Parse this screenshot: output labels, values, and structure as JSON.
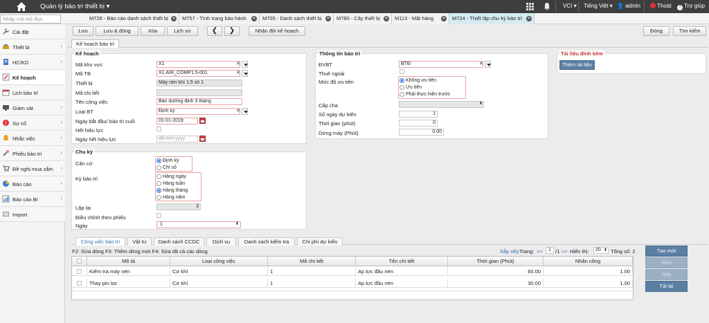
{
  "header": {
    "app_title": "Quản lý bảo trì thiết bị",
    "vci": "VCI",
    "language": "Tiếng Việt",
    "user": "admin",
    "logout": "Thoát",
    "help": "Trợ giúp"
  },
  "search": {
    "placeholder": "Nhập mã mô đun"
  },
  "doc_tabs": [
    {
      "label": "M726 - Báo cáo danh sách thiết bị",
      "active": false
    },
    {
      "label": "M757 - Tình trạng bảo hành",
      "active": false
    },
    {
      "label": "M705 - Danh sách thiết bị",
      "active": false
    },
    {
      "label": "M780 - Cây thiết bị",
      "active": false
    },
    {
      "label": "M113 - Mặt hàng",
      "active": false
    },
    {
      "label": "M724 - Thiết lập chu kỳ bảo trì",
      "active": true
    }
  ],
  "sidebar": {
    "items": [
      {
        "label": "Cài đặt",
        "icon": "wrench-icon",
        "expandable": false
      },
      {
        "label": "Thiết bị",
        "icon": "device-icon",
        "expandable": true
      },
      {
        "label": "HC/KD",
        "icon": "document-icon",
        "expandable": true
      },
      {
        "label": "Kế hoạch",
        "icon": "plan-icon",
        "expandable": false
      },
      {
        "label": "Lịch bảo trì",
        "icon": "calendar-icon",
        "expandable": false
      },
      {
        "label": "Giám sát",
        "icon": "monitor-icon",
        "expandable": true
      },
      {
        "label": "Sự cố",
        "icon": "incident-icon",
        "expandable": true
      },
      {
        "label": "Nhắc việc",
        "icon": "reminder-icon",
        "expandable": true
      },
      {
        "label": "Phiếu bảo trì",
        "icon": "ticket-icon",
        "expandable": true
      },
      {
        "label": "Đề nghị mua sắm",
        "icon": "purchase-icon",
        "expandable": true
      },
      {
        "label": "Báo cáo",
        "icon": "report-icon",
        "expandable": true
      },
      {
        "label": "Báo cáo BI",
        "icon": "bi-report-icon",
        "expandable": true
      },
      {
        "label": "Import",
        "icon": "import-icon",
        "expandable": false
      }
    ]
  },
  "toolbar": {
    "save": "Lưu",
    "save_close": "Lưu & đóng",
    "delete": "Xóa",
    "history": "Lịch sử",
    "duplicate": "Nhân đôi kế hoạch",
    "close": "Đóng",
    "find": "Tìm kiếm"
  },
  "form_tab": "Kế hoạch bảo trì",
  "plan": {
    "legend": "Kế hoạch",
    "area_label": "Mã khu vực",
    "area_value": "X1",
    "equip_code_label": "Mã TB",
    "equip_code_value": "X1.AIR_COMP1.5-001",
    "equip_label": "Thiết bị",
    "equip_value": "Máy nén khí 1.5 số 1",
    "detail_code_label": "Mã chi tiết",
    "detail_code_value": "",
    "job_label": "Tên công việc",
    "job_value": "Bảo dưỡng định 3 tháng",
    "type_label": "Loại BT",
    "type_value": "Định kỳ",
    "start_label": "Ngày bắt đầu/ bảo trì cuối",
    "start_value": "01-01-2019",
    "expired_label": "Hết hiệu lực",
    "expiry_date_label": "Ngày hết hiệu lực",
    "expiry_date_placeholder": "dd-mm-yyyy"
  },
  "cycle": {
    "legend": "Chu kỳ",
    "basis_label": "Căn cứ",
    "basis_options": [
      "Định kỳ",
      "Chỉ số"
    ],
    "basis_selected": 0,
    "period_label": "Kỳ bảo trì",
    "period_options": [
      "Hàng ngày",
      "Hàng tuần",
      "Hàng tháng",
      "Hàng năm"
    ],
    "period_selected": 2,
    "repeat_label": "Lặp lại",
    "repeat_value": "3",
    "adjust_label": "Điều chỉnh theo phiếu",
    "day_label": "Ngày",
    "day_value": "1"
  },
  "maint_info": {
    "legend": "Thông tin bảo trì",
    "unit_label": "ĐVBT",
    "unit_value": "BTĐ",
    "outsource_label": "Thuê ngoài",
    "priority_label": "Mức độ ưu tiên",
    "priority_options": [
      "Không ưu tiên",
      "Ưu tiên",
      "Phải thực hiện trước"
    ],
    "priority_selected": 0,
    "parent_label": "Cấp cha",
    "parent_value": "",
    "est_days_label": "Số ngày dự kiến",
    "est_days_value": "1",
    "time_label": "Thời gian (phút)",
    "time_value": "0",
    "downtime_label": "Dừng máy (Phút)",
    "downtime_value": "0.00"
  },
  "attachments": {
    "legend": "Tài liệu đính kèm",
    "add_button": "Thêm tài liệu"
  },
  "bottom_tabs": [
    {
      "label": "Công việc bảo trì",
      "active": true
    },
    {
      "label": "Vật tư",
      "active": false
    },
    {
      "label": "Danh sách CCDC",
      "active": false
    },
    {
      "label": "Dịch vụ",
      "active": false
    },
    {
      "label": "Danh sách kiểm tra",
      "active": false
    },
    {
      "label": "Chi phí dự kiến",
      "active": false
    }
  ],
  "grid": {
    "hint": "F2: Sửa dòng F3: Thêm dòng mới F4: Sửa tất cả các dòng",
    "sort_label": "Sắp xếp",
    "page_label": "Trang:",
    "prev": "<<",
    "page": "1",
    "page_total": "/1",
    "next": ">>",
    "show_label": "Hiển thị:",
    "page_size": "20",
    "total_label": "Tổng số: 2",
    "headers": [
      "Mô tả",
      "Loại công việc",
      "Mã chi tiết",
      "Tên chi tiết",
      "Thời gian (Phút)",
      "Nhân công"
    ],
    "rows": [
      [
        "Kiểm tra máy nén",
        "Cơ khí",
        "1",
        "Ap lực đầu nén",
        "60.00",
        "1.00"
      ],
      [
        "Thay pin lọc",
        "Cơ khí",
        "1",
        "Ap lực đầu nén",
        "30.00",
        "1.00"
      ]
    ]
  },
  "side_actions": {
    "new": "Tạo mới",
    "edit": "Sửa",
    "delete": "Xóa",
    "reload": "Tải lại"
  }
}
